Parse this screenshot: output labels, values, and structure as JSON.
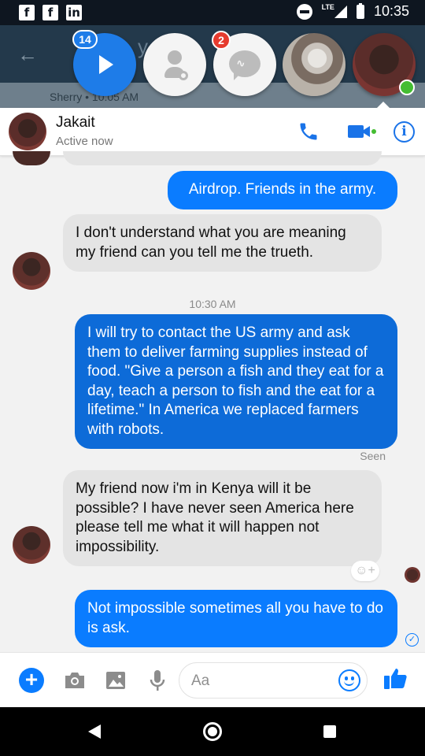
{
  "status_bar": {
    "time": "10:35",
    "network": "LTE",
    "notification_icons": [
      "facebook-icon",
      "facebook-icon",
      "linkedin-icon"
    ]
  },
  "background_thread": {
    "title_fragment": "y M          d",
    "subtitle": "Sherry • 10:05 AM"
  },
  "chat_heads": {
    "video_badge": "14",
    "messenger_badge": "2"
  },
  "chat_header": {
    "name": "Jakait",
    "status": "Active now"
  },
  "messages": [
    {
      "id": "m1",
      "direction": "out",
      "text": "Airdrop. Friends in the army."
    },
    {
      "id": "m2",
      "direction": "in",
      "text": "I don't understand what you are meaning my friend can you tell me the trueth."
    },
    {
      "id": "m3",
      "direction": "out",
      "timestamp": "10:30 AM",
      "text": "I will try to contact the US army and ask them to deliver farming supplies instead of food. \"Give a person a fish and they eat for a day, teach a person to fish and the eat for a lifetime.\" In America we replaced farmers with robots.",
      "receipt": "Seen"
    },
    {
      "id": "m4",
      "direction": "in",
      "text": "My friend now i'm in Kenya will it be possible? I have never seen America here please tell me what it will happen not impossibility."
    },
    {
      "id": "m5",
      "direction": "out",
      "text": "Not impossible sometimes all you have to do is ask."
    }
  ],
  "composer": {
    "placeholder": "Aa"
  },
  "colors": {
    "accent": "#0a7cff",
    "incoming_bubble": "#e4e4e4",
    "online": "#44bd32",
    "badge_red": "#e63b2e"
  }
}
